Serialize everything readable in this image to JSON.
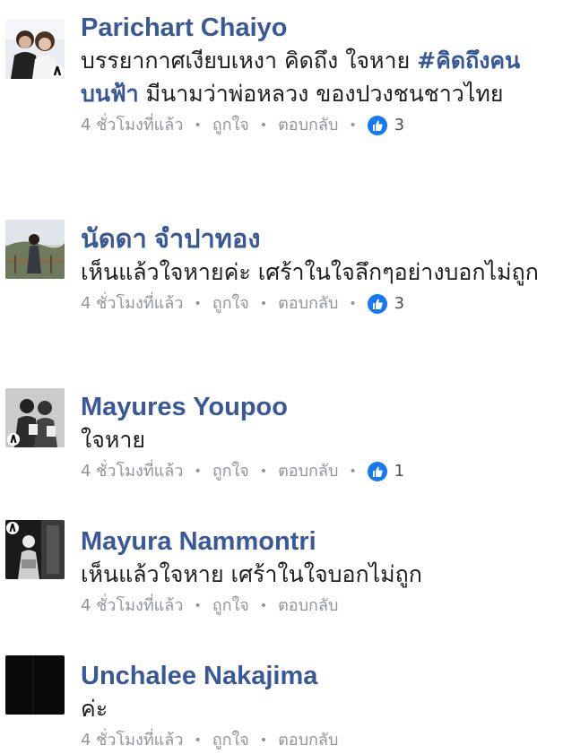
{
  "comments": [
    {
      "author": "Parichart Chaiyo",
      "text_plain": "บรรยากาศเงียบเหงา คิดถึง ใจหาย ",
      "hashtag": "#คิดถึงคนบนฟ้า",
      "text_after": " มีนามว่าพ่อหลวง ของปวงชนชาวไทย",
      "time": "4 ชั่วโมงที่แล้ว",
      "like_label": "ถูกใจ",
      "reply_label": "ตอบกลับ",
      "like_count": "3"
    },
    {
      "author": "นัดดา จำปาทอง",
      "text_plain": "เห็นแล้วใจหายค่ะ เศร้าในใจลึกๆอย่างบอกไม่ถูก",
      "time": "4 ชั่วโมงที่แล้ว",
      "like_label": "ถูกใจ",
      "reply_label": "ตอบกลับ",
      "like_count": "3"
    },
    {
      "author": "Mayures Youpoo",
      "text_plain": "ใจหาย",
      "time": "4 ชั่วโมงที่แล้ว",
      "like_label": "ถูกใจ",
      "reply_label": "ตอบกลับ",
      "like_count": "1"
    },
    {
      "author": "Mayura Nammontri",
      "text_plain": "เห็นแล้วใจหาย เศร้าในใจบอกไม่ถูก",
      "time": "4 ชั่วโมงที่แล้ว",
      "like_label": "ถูกใจ",
      "reply_label": "ตอบกลับ"
    },
    {
      "author": "Unchalee Nakajima",
      "text_plain": "ค่ะ",
      "time": "4 ชั่วโมงที่แล้ว",
      "like_label": "ถูกใจ",
      "reply_label": "ตอบกลับ"
    }
  ],
  "colors": {
    "author": "#385898",
    "meta": "#90949c",
    "like_blue": "#1877f2"
  },
  "icons": {
    "like": "thumbs-up-icon",
    "mourning": "black-ribbon-icon"
  }
}
